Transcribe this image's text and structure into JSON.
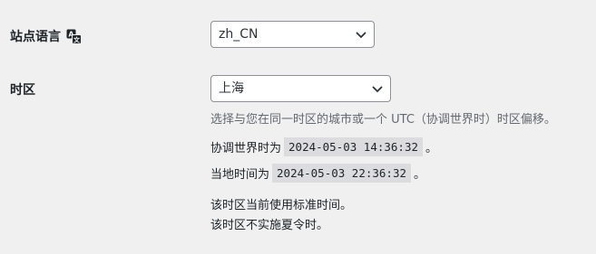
{
  "site_language": {
    "label": "站点语言",
    "selected": "zh_CN"
  },
  "timezone": {
    "label": "时区",
    "selected": "上海",
    "description": "选择与您在同一时区的城市或一个 UTC（协调世界时）时区偏移。",
    "utc_prefix": "协调世界时为",
    "utc_time": "2024-05-03 14:36:32",
    "utc_suffix": "。",
    "local_prefix": "当地时间为",
    "local_time": "2024-05-03 22:36:32",
    "local_suffix": "。",
    "note_standard": "该时区当前使用标准时间。",
    "note_dst": "该时区不实施夏令时。"
  },
  "icons": {
    "language": "translation-icon",
    "dropdown": "chevron-down-icon"
  }
}
